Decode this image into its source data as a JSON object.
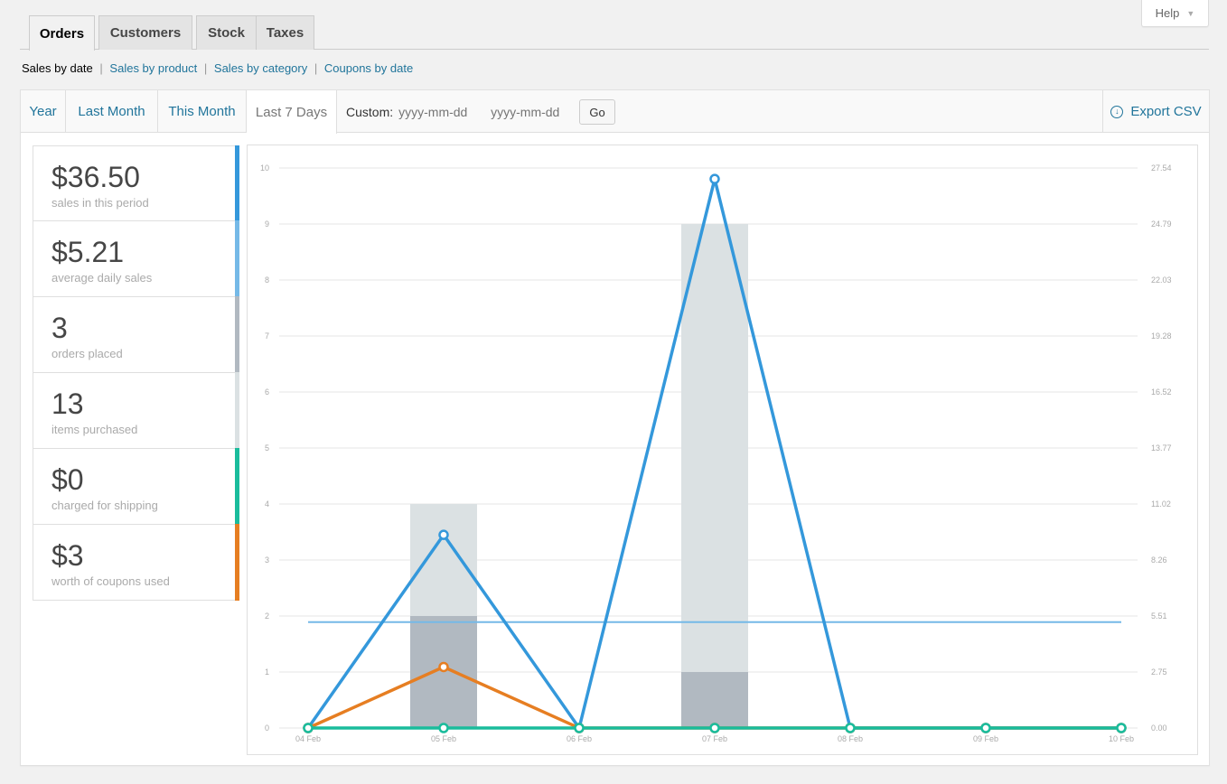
{
  "help": {
    "label": "Help"
  },
  "tabs": [
    {
      "label": "Orders",
      "active": true
    },
    {
      "label": "Customers"
    },
    {
      "label": "Stock"
    },
    {
      "label": "Taxes"
    }
  ],
  "sublinks": {
    "current": "Sales by date",
    "links": [
      "Sales by product",
      "Sales by category",
      "Coupons by date"
    ],
    "separator": "|"
  },
  "range": {
    "items": [
      "Year",
      "Last Month",
      "This Month",
      "Last 7 Days"
    ],
    "active": "Last 7 Days",
    "custom_label": "Custom:",
    "from_placeholder": "yyyy-mm-dd",
    "to_placeholder": "yyyy-mm-dd",
    "go_label": "Go",
    "export_label": "Export CSV",
    "export_icon": "download-icon"
  },
  "legend": [
    {
      "value": "$36.50",
      "label": "sales in this period",
      "color": "#3498db"
    },
    {
      "value": "$5.21",
      "label": "average daily sales",
      "color": "#75b9e7"
    },
    {
      "value": "3",
      "label": "orders placed",
      "color": "#b1b9c1"
    },
    {
      "value": "13",
      "label": "items purchased",
      "color": "#dbe1e3"
    },
    {
      "value": "$0",
      "label": "charged for shipping",
      "color": "#1abc9c"
    },
    {
      "value": "$3",
      "label": "worth of coupons used",
      "color": "#e67e22"
    }
  ],
  "chart_data": {
    "type": "bar+line",
    "categories": [
      "04 Feb",
      "05 Feb",
      "06 Feb",
      "07 Feb",
      "08 Feb",
      "09 Feb",
      "10 Feb"
    ],
    "y_left_ticks": [
      "0",
      "1",
      "2",
      "3",
      "4",
      "5",
      "6",
      "7",
      "8",
      "9",
      "10"
    ],
    "y_right_ticks": [
      "0.00",
      "2.75",
      "5.51",
      "8.26",
      "11.02",
      "13.77",
      "16.52",
      "19.28",
      "22.03",
      "24.79",
      "27.54"
    ],
    "ylim_left": [
      0,
      10
    ],
    "ylim_right": [
      0,
      27.54
    ],
    "grid": true,
    "series": [
      {
        "axis": "left",
        "kind": "bar",
        "color": "#dbe1e3",
        "values": [
          0,
          4,
          0,
          9,
          0,
          0,
          0
        ]
      },
      {
        "axis": "left",
        "kind": "bar",
        "color": "#b1b9c1",
        "values": [
          0,
          2,
          0,
          1,
          0,
          0,
          0
        ]
      },
      {
        "axis": "right",
        "kind": "line",
        "color": "#75b9e7",
        "values": [
          5.21,
          5.21,
          5.21,
          5.21,
          5.21,
          5.21,
          5.21
        ]
      },
      {
        "axis": "right",
        "kind": "line",
        "color": "#3498db",
        "values": [
          0,
          9.5,
          0,
          27.0,
          0,
          0,
          0
        ]
      },
      {
        "axis": "right",
        "kind": "line",
        "color": "#e67e22",
        "values": [
          0,
          3,
          0,
          0,
          0,
          0,
          0
        ]
      },
      {
        "axis": "right",
        "kind": "line",
        "color": "#1abc9c",
        "values": [
          0,
          0,
          0,
          0,
          0,
          0,
          0
        ]
      }
    ]
  }
}
